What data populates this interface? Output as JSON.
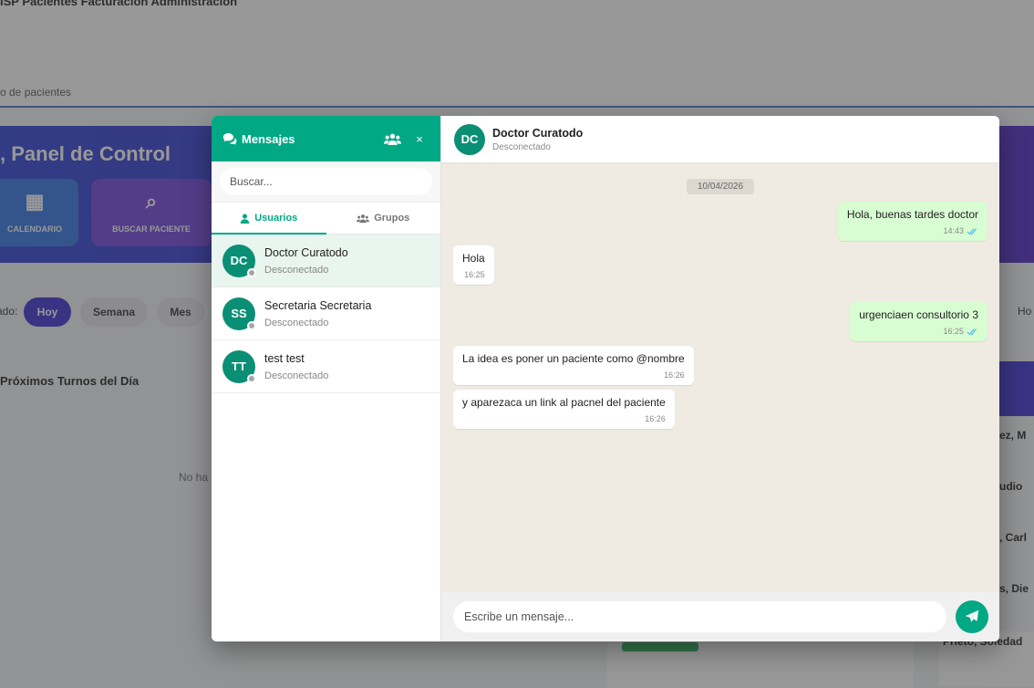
{
  "background": {
    "nav_text": "ISP  Pacientes  Facturación  Administración",
    "search_text": "o de pacientes",
    "banner_title": ", Panel de Control",
    "cards": [
      "CALENDARIO",
      "BUSCAR PACIENTE"
    ],
    "filter_label": "ado:",
    "filters": [
      "Hoy",
      "Semana",
      "Mes"
    ],
    "section_title": "Próximos Turnos del Día",
    "empty_text": "No ha",
    "right_labels": [
      "Ho"
    ],
    "right_items": [
      "ez, M",
      "udio",
      ", Carl",
      "s, Die"
    ],
    "right_card_text": "Prieto, Soledad"
  },
  "sidebar": {
    "title": "Mensajes",
    "close_label": "×",
    "search_placeholder": "Buscar...",
    "tabs": [
      {
        "label": "Usuarios",
        "active": true
      },
      {
        "label": "Grupos",
        "active": false
      }
    ],
    "contacts": [
      {
        "initials": "DC",
        "name": "Doctor Curatodo",
        "status": "Desconectado",
        "active": true
      },
      {
        "initials": "SS",
        "name": "Secretaria Secretaria",
        "status": "Desconectado",
        "active": false
      },
      {
        "initials": "TT",
        "name": "test test",
        "status": "Desconectado",
        "active": false
      }
    ]
  },
  "chat": {
    "header": {
      "initials": "DC",
      "name": "Doctor Curatodo",
      "status": "Desconectado"
    },
    "date": "10/04/2026",
    "messages": [
      {
        "direction": "out",
        "text": "Hola, buenas tardes doctor",
        "time": "14:43",
        "read": true
      },
      {
        "direction": "in",
        "text": "Hola",
        "time": "16:25",
        "read": false
      },
      {
        "direction": "out",
        "text": "urgenciaen consultorio 3",
        "time": "16:25",
        "read": true
      },
      {
        "direction": "in",
        "text": "La idea es poner un paciente como @nombre",
        "time": "16:26",
        "read": false
      },
      {
        "direction": "in",
        "text": "y aparezaca un link al pacnel del paciente",
        "time": "16:26",
        "read": false
      }
    ],
    "input_placeholder": "Escribe un mensaje..."
  },
  "colors": {
    "accent": "#00a884",
    "avatar": "#0b8f74",
    "outgoing_bubble": "#d9fdd3",
    "chat_background": "#efeae2",
    "read_check": "#53bdeb"
  }
}
